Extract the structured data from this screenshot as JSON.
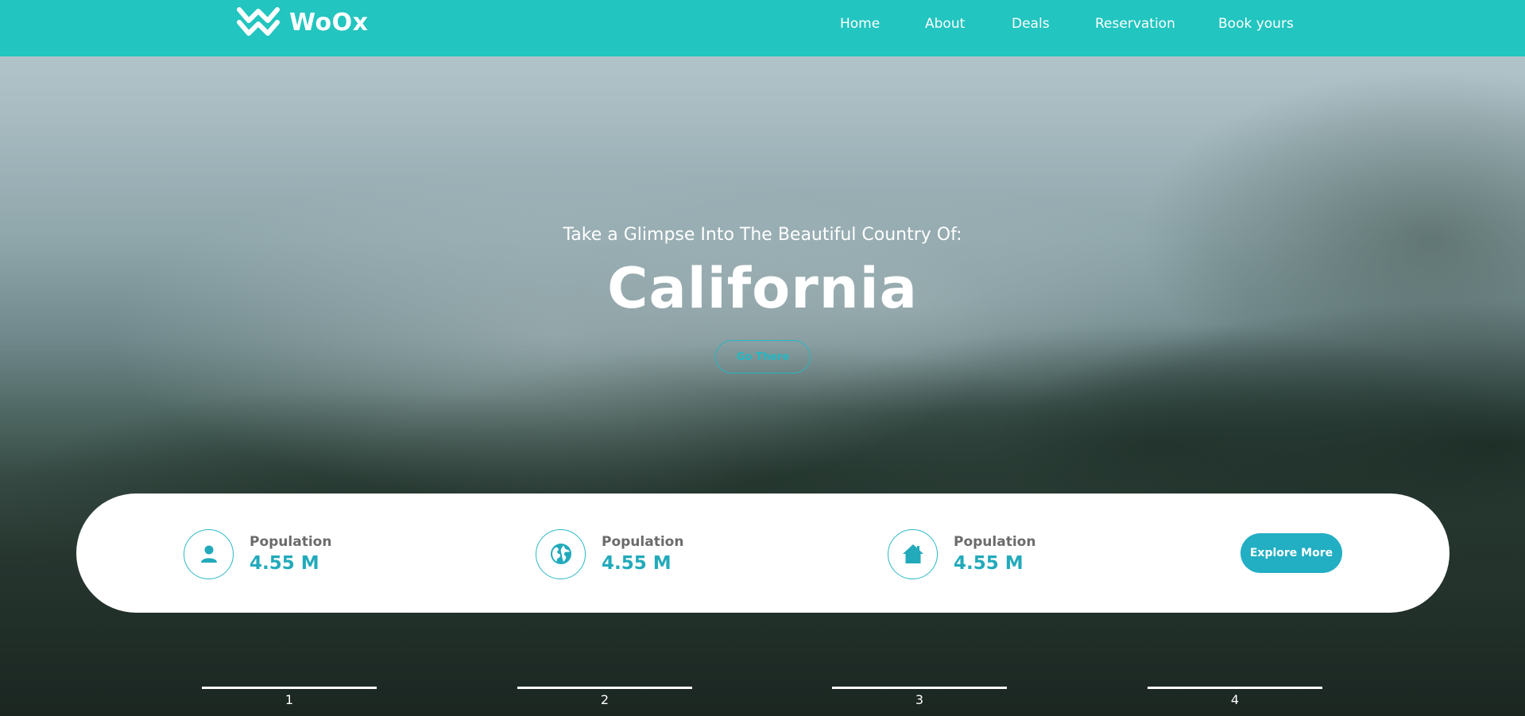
{
  "header": {
    "brand": "WoOx",
    "nav": [
      {
        "label": "Home"
      },
      {
        "label": "About"
      },
      {
        "label": "Deals"
      },
      {
        "label": "Reservation"
      },
      {
        "label": "Book yours"
      }
    ]
  },
  "hero": {
    "subtitle": "Take a Glimpse Into The Beautiful Country Of:",
    "title": "California",
    "button": "Go There"
  },
  "stats": {
    "items": [
      {
        "icon": "user-icon",
        "label": "Population",
        "value": "4.55 M"
      },
      {
        "icon": "globe-icon",
        "label": "Population",
        "value": "4.55 M"
      },
      {
        "icon": "home-icon",
        "label": "Population",
        "value": "4.55 M"
      }
    ],
    "button": "Explore More"
  },
  "slider": {
    "indicators": [
      "1",
      "2",
      "3",
      "4"
    ]
  },
  "colors": {
    "header": "#22c5bf",
    "accent": "#22aec3",
    "card": "#ffffff"
  }
}
